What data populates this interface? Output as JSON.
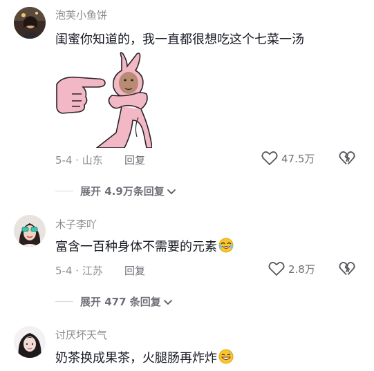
{
  "comments": [
    {
      "username": "泡芙小鱼饼",
      "text": "闺蜜你知道的，我一直都很想吃这个七菜一汤",
      "date_location": "5-4 · 山东",
      "reply_label": "回复",
      "likes": "47.5万",
      "expand_label": "展开 4.9万条回复"
    },
    {
      "username": "木子李吖",
      "text": "富含一百种身体不需要的元素",
      "date_location": "5-4 · 江苏",
      "reply_label": "回复",
      "likes": "2.8万",
      "expand_label": "展开 477 条回复"
    },
    {
      "username": "讨厌坏天气",
      "text": "奶茶换成果茶，火腿肠再炸炸"
    }
  ],
  "icons": {
    "like": "heart-outline-icon",
    "dislike": "broken-heart-icon",
    "expand": "chevron-down-icon",
    "emoji_laugh": "rolling-laughing-emoji",
    "emoji_grin": "grinning-sweat-emoji"
  },
  "colors": {
    "text": "#161823",
    "muted": "#8a8b91",
    "action": "#6f7077",
    "sticker_pink": "#f2b8c6"
  }
}
